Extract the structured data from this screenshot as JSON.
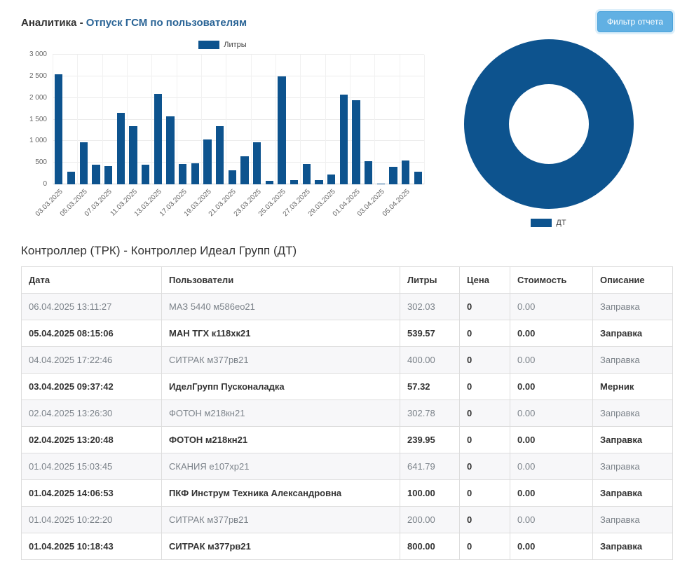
{
  "header": {
    "title_prefix": "Аналитика - ",
    "title": "Отпуск ГСМ по пользователям",
    "filter_button": "Фильтр отчета"
  },
  "colors": {
    "accent": "#0d538e",
    "link_blue": "#2a6496"
  },
  "chart_data": [
    {
      "type": "bar",
      "series_label": "Литры",
      "bar_color": "#0d538e",
      "ylim": [
        0,
        3000
      ],
      "y_ticks": [
        "0",
        "500",
        "1 000",
        "1 500",
        "2 000",
        "2 500",
        "3 000"
      ],
      "x_labels": [
        "03.03.2025",
        "05.03.2025",
        "07.03.2025",
        "11.03.2025",
        "13.03.2025",
        "17.03.2025",
        "19.03.2025",
        "21.03.2025",
        "23.03.2025",
        "25.03.2025",
        "27.03.2025",
        "29.03.2025",
        "01.04.2025",
        "03.04.2025",
        "05.04.2025"
      ],
      "values": [
        2550,
        300,
        980,
        450,
        420,
        1650,
        1340,
        450,
        2100,
        1570,
        470,
        490,
        1030,
        1340,
        320,
        650,
        980,
        80,
        2500,
        90,
        470,
        100,
        230,
        2080,
        1950,
        540,
        20,
        400,
        550,
        300
      ],
      "legend_position": "top",
      "grid": true
    },
    {
      "type": "pie",
      "donut": true,
      "color": "#0d538e",
      "slices": [
        {
          "label": "ДТ",
          "value": 100
        }
      ],
      "legend_position": "bottom"
    }
  ],
  "table_section": {
    "title": "Контроллер (ТРК) - Контроллер Идеал Групп (ДТ)",
    "columns": [
      "Дата",
      "Пользователи",
      "Литры",
      "Цена",
      "Стоимость",
      "Описание"
    ],
    "rows": [
      [
        "06.04.2025 13:11:27",
        "МАЗ 5440 м586ео21",
        "302.03",
        "0",
        "0.00",
        "Заправка"
      ],
      [
        "05.04.2025 08:15:06",
        "МАН ТГХ к118хк21",
        "539.57",
        "0",
        "0.00",
        "Заправка"
      ],
      [
        "04.04.2025 17:22:46",
        "СИТРАК м377рв21",
        "400.00",
        "0",
        "0.00",
        "Заправка"
      ],
      [
        "03.04.2025 09:37:42",
        "ИделГрупп Пусконаладка",
        "57.32",
        "0",
        "0.00",
        "Мерник"
      ],
      [
        "02.04.2025 13:26:30",
        "ФОТОН м218кн21",
        "302.78",
        "0",
        "0.00",
        "Заправка"
      ],
      [
        "02.04.2025 13:20:48",
        "ФОТОН м218кн21",
        "239.95",
        "0",
        "0.00",
        "Заправка"
      ],
      [
        "01.04.2025 15:03:45",
        "СКАНИЯ е107хр21",
        "641.79",
        "0",
        "0.00",
        "Заправка"
      ],
      [
        "01.04.2025 14:06:53",
        "ПКФ Инструм Техника Александровна",
        "100.00",
        "0",
        "0.00",
        "Заправка"
      ],
      [
        "01.04.2025 10:22:20",
        "СИТРАК м377рв21",
        "200.00",
        "0",
        "0.00",
        "Заправка"
      ],
      [
        "01.04.2025 10:18:43",
        "СИТРАК м377рв21",
        "800.00",
        "0",
        "0.00",
        "Заправка"
      ]
    ]
  }
}
